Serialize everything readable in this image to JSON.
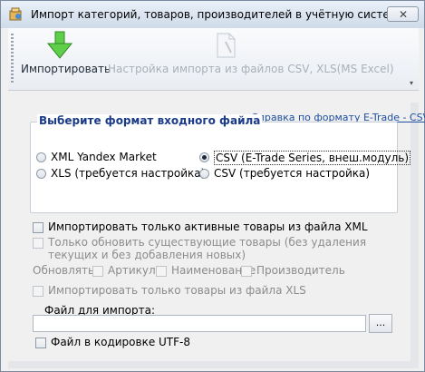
{
  "window": {
    "title": "Импорт категорий, товаров, производителей в учётную систему",
    "close_symbol": "✕"
  },
  "toolbar": {
    "import_label": "Импортировать",
    "import_icon": "down-arrow-icon",
    "settings_label": "Настройка импорта из файлов CSV, XLS(MS Excel)",
    "settings_icon": "document-icon",
    "overflow_symbol": "▾"
  },
  "format_group": {
    "title": "Выберите формат входного файла",
    "help_link": "Справка по формату E-Trade - CSV",
    "options": [
      {
        "label": "XML Yandex Market",
        "checked": false
      },
      {
        "label": "XLS (требуется настройка)",
        "checked": false
      },
      {
        "label": "CSV (E-Trade Series, внеш.модуль)",
        "checked": true
      },
      {
        "label": "CSV (требуется настройка)",
        "checked": false
      }
    ]
  },
  "options": {
    "import_active_xml": "Импортировать только активные товары из файла XML",
    "update_existing": "Только обновить существующие товары (без удаления",
    "update_existing_line2": "текущих и без добавления новых)",
    "update_label": "Обновлять:",
    "update_article": "Артикул",
    "update_name": "Наименование",
    "update_manufacturer": "Производитель",
    "import_xls_only": "Импортировать только товары из файла XLS"
  },
  "file": {
    "label": "Файл для импорта:",
    "value": "",
    "browse_label": "...",
    "utf8_label": "Файл в кодировке UTF-8"
  },
  "colors": {
    "link": "#1f4fa0",
    "group_title": "#1a3a8a",
    "disabled_text": "#8c8c8c",
    "import_arrow": "#3bb23a"
  }
}
